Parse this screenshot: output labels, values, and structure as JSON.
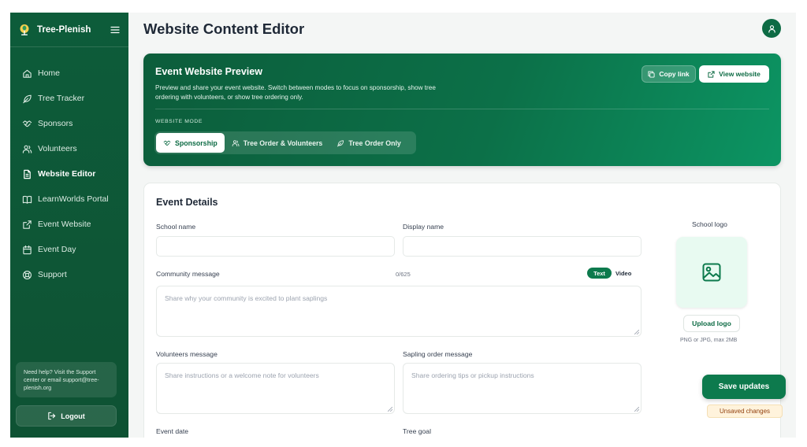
{
  "app": {
    "name": "Tree-Plenish"
  },
  "sidebar": {
    "items": [
      {
        "label": "Home",
        "icon": "home-icon"
      },
      {
        "label": "Tree Tracker",
        "icon": "leaf-icon"
      },
      {
        "label": "Sponsors",
        "icon": "handshake-icon"
      },
      {
        "label": "Volunteers",
        "icon": "users-icon"
      },
      {
        "label": "Website Editor",
        "icon": "document-icon",
        "active": true
      },
      {
        "label": "LearnWorlds Portal",
        "icon": "book-icon"
      },
      {
        "label": "Event Website",
        "icon": "external-link-icon"
      },
      {
        "label": "Event Day",
        "icon": "calendar-icon"
      },
      {
        "label": "Support",
        "icon": "lifebuoy-icon"
      }
    ],
    "help_text": "Need help? Visit the Support center or email support@tree-plenish.org",
    "logout_label": "Logout"
  },
  "header": {
    "title": "Website Content Editor"
  },
  "preview": {
    "title": "Event Website Preview",
    "description": "Preview and share your event website. Switch between modes to focus on sponsorship, show tree ordering with volunteers, or show tree ordering only.",
    "copy_link_label": "Copy link",
    "view_website_label": "View website",
    "mode_label": "WEBSITE MODE",
    "modes": [
      {
        "label": "Sponsorship",
        "active": true
      },
      {
        "label": "Tree Order & Volunteers",
        "active": false
      },
      {
        "label": "Tree Order Only",
        "active": false
      }
    ]
  },
  "event_details": {
    "title": "Event Details",
    "school_name": {
      "label": "School name",
      "value": ""
    },
    "display_name": {
      "label": "Display name",
      "value": ""
    },
    "community_message": {
      "label": "Community message",
      "counter": "0/625",
      "toggle_text": "Text",
      "toggle_video": "Video",
      "placeholder": "Share why your community is excited to plant saplings"
    },
    "volunteers_message": {
      "label": "Volunteers message",
      "placeholder": "Share instructions or a welcome note for volunteers"
    },
    "sapling_order_message": {
      "label": "Sapling order message",
      "placeholder": "Share ordering tips or pickup instructions"
    },
    "event_date": {
      "label": "Event date"
    },
    "tree_goal": {
      "label": "Tree goal"
    },
    "school_logo": {
      "label": "School logo",
      "upload_label": "Upload logo",
      "hint": "PNG or JPG, max 2MB"
    }
  },
  "actions": {
    "save_label": "Save updates",
    "unsaved_label": "Unsaved changes"
  },
  "colors": {
    "brand": "#0d6b44",
    "accent": "#0d7a4d",
    "sidebar": "#0d5c3a"
  }
}
